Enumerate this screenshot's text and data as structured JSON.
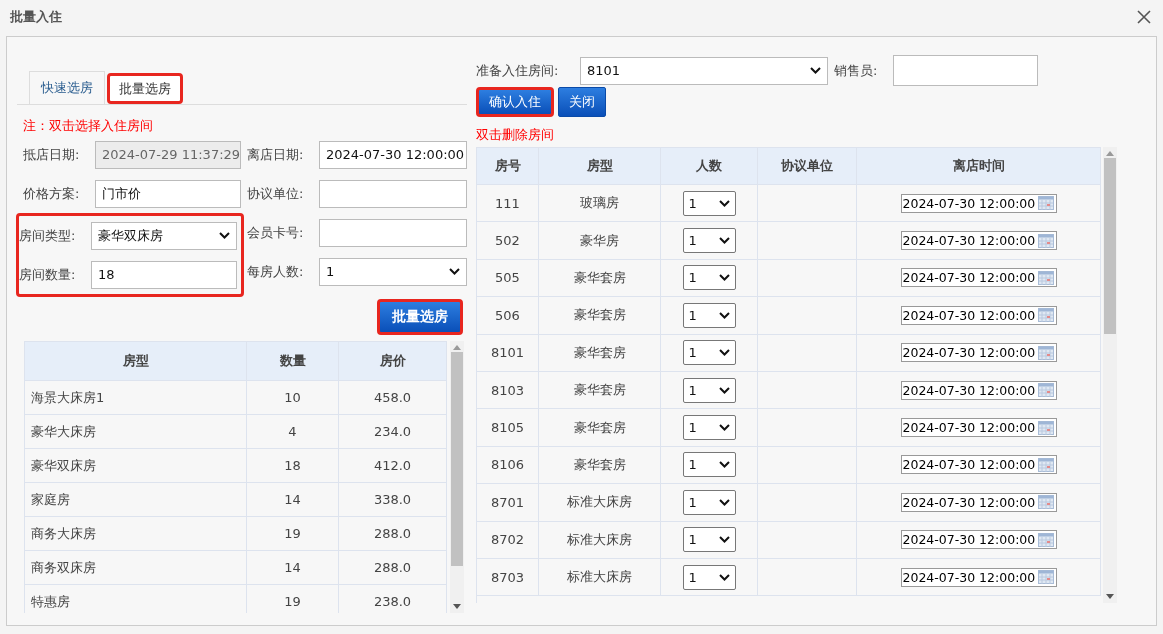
{
  "window": {
    "title": "批量入住"
  },
  "left": {
    "tabs": [
      {
        "label": "快速选房",
        "selected": false,
        "highlighted": false
      },
      {
        "label": "批量选房",
        "selected": true,
        "highlighted": true
      }
    ],
    "note": "注：双击选择入住房间",
    "form_sections": [
      {
        "left": [
          {
            "label": "抵店日期:",
            "kind": "text",
            "value": "2024-07-29 11:37:29",
            "disabled": true
          },
          {
            "label": "价格方案:",
            "kind": "text",
            "value": "门市价"
          }
        ],
        "right": [
          {
            "label": "离店日期:",
            "kind": "text",
            "value": "2024-07-30 12:00:00"
          },
          {
            "label": "协议单位:",
            "kind": "text"
          }
        ]
      },
      {
        "highlighted": true,
        "left": [
          {
            "label": "房间类型:",
            "kind": "select",
            "value": "豪华双床房"
          },
          {
            "label": "房间数量:",
            "kind": "text",
            "value": "18"
          }
        ],
        "right": [
          {
            "label": "会员卡号:",
            "kind": "text"
          },
          {
            "label": "每房人数:",
            "kind": "select",
            "value": "1"
          }
        ]
      }
    ],
    "batch_button": {
      "label": "批量选房",
      "highlighted": true
    },
    "table": {
      "columns": [
        "房型",
        "数量",
        "房价"
      ],
      "rows": [
        [
          "海景大床房1",
          "10",
          "458.0"
        ],
        [
          "豪华大床房",
          "4",
          "234.0"
        ],
        [
          "豪华双床房",
          "18",
          "412.0"
        ],
        [
          "家庭房",
          "14",
          "338.0"
        ],
        [
          "商务大床房",
          "19",
          "288.0"
        ],
        [
          "商务双床房",
          "14",
          "288.0"
        ],
        [
          "特惠房",
          "19",
          "238.0"
        ]
      ]
    }
  },
  "right": {
    "room_label": "准备入住房间:",
    "room_value": "8101",
    "sales_label": "销售员:",
    "buttons": [
      {
        "label": "确认入住",
        "highlighted": true
      },
      {
        "label": "关闭",
        "highlighted": false
      }
    ],
    "note": "双击删除房间",
    "table": {
      "columns": [
        "房号",
        "房型",
        "人数",
        "协议单位",
        "离店时间"
      ],
      "rows": [
        {
          "room": "111",
          "type": "玻璃房",
          "people": "1",
          "departure": "2024-07-30 12:00:00"
        },
        {
          "room": "502",
          "type": "豪华房",
          "people": "1",
          "departure": "2024-07-30 12:00:00"
        },
        {
          "room": "505",
          "type": "豪华套房",
          "people": "1",
          "departure": "2024-07-30 12:00:00"
        },
        {
          "room": "506",
          "type": "豪华套房",
          "people": "1",
          "departure": "2024-07-30 12:00:00"
        },
        {
          "room": "8101",
          "type": "豪华套房",
          "people": "1",
          "departure": "2024-07-30 12:00:00"
        },
        {
          "room": "8103",
          "type": "豪华套房",
          "people": "1",
          "departure": "2024-07-30 12:00:00"
        },
        {
          "room": "8105",
          "type": "豪华套房",
          "people": "1",
          "departure": "2024-07-30 12:00:00"
        },
        {
          "room": "8106",
          "type": "豪华套房",
          "people": "1",
          "departure": "2024-07-30 12:00:00"
        },
        {
          "room": "8701",
          "type": "标准大床房",
          "people": "1",
          "departure": "2024-07-30 12:00:00"
        },
        {
          "room": "8702",
          "type": "标准大床房",
          "people": "1",
          "departure": "2024-07-30 12:00:00"
        },
        {
          "room": "8703",
          "type": "标准大床房",
          "people": "1",
          "departure": "2024-07-30 12:00:00"
        }
      ]
    }
  }
}
